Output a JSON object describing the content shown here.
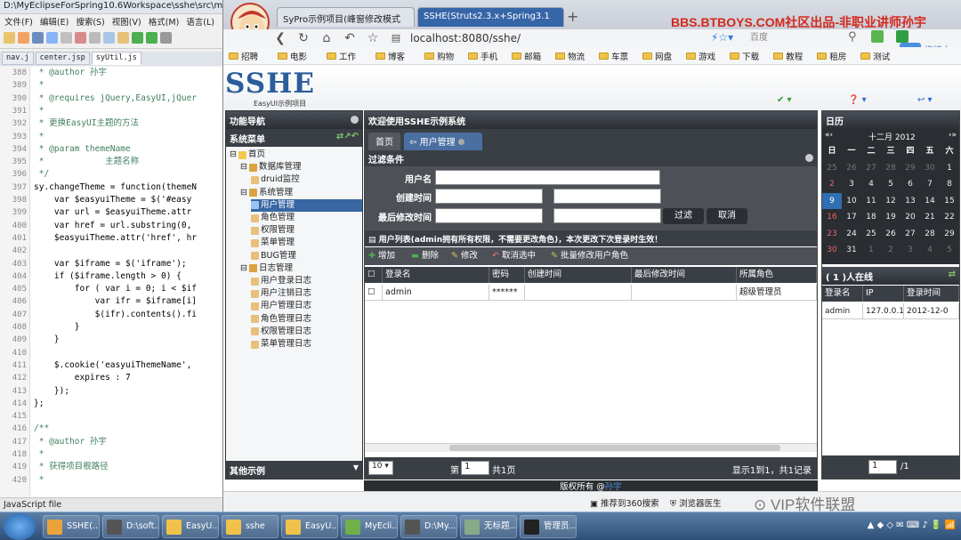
{
  "eclipse": {
    "title": "D:\\MyEclipseForSpring10.6Workspace\\sshe\\src\\m",
    "menu": [
      "文件(F)",
      "编辑(E)",
      "搜索(S)",
      "视图(V)",
      "格式(M)",
      "语言(L)"
    ],
    "tabs": [
      "nav.j",
      "center.jsp",
      "syUtil.js"
    ],
    "lines": [
      {
        "n": "388",
        "t": " * @author 孙宇"
      },
      {
        "n": "389",
        "t": " *"
      },
      {
        "n": "390",
        "t": " * @requires jQuery,EasyUI,jQuer"
      },
      {
        "n": "391",
        "t": " *"
      },
      {
        "n": "392",
        "t": " * 更换EasyUI主题的方法"
      },
      {
        "n": "393",
        "t": " *"
      },
      {
        "n": "394",
        "t": " * @param themeName"
      },
      {
        "n": "395",
        "t": " *            主题名称"
      },
      {
        "n": "396",
        "t": " */"
      },
      {
        "n": "397",
        "t": "sy.changeTheme = function(themeN"
      },
      {
        "n": "398",
        "t": "    var $easyuiTheme = $('#easy"
      },
      {
        "n": "399",
        "t": "    var url = $easyuiTheme.attr"
      },
      {
        "n": "400",
        "t": "    var href = url.substring(0,"
      },
      {
        "n": "401",
        "t": "    $easyuiTheme.attr('href', hr"
      },
      {
        "n": "402",
        "t": ""
      },
      {
        "n": "403",
        "t": "    var $iframe = $('iframe');"
      },
      {
        "n": "404",
        "t": "    if ($iframe.length > 0) {"
      },
      {
        "n": "405",
        "t": "        for ( var i = 0; i < $if"
      },
      {
        "n": "406",
        "t": "            var ifr = $iframe[i]"
      },
      {
        "n": "407",
        "t": "            $(ifr).contents().fi"
      },
      {
        "n": "408",
        "t": "        }"
      },
      {
        "n": "409",
        "t": "    }"
      },
      {
        "n": "410",
        "t": ""
      },
      {
        "n": "411",
        "t": "    $.cookie('easyuiThemeName',"
      },
      {
        "n": "412",
        "t": "        expires : 7"
      },
      {
        "n": "413",
        "t": "    });"
      },
      {
        "n": "414",
        "t": "};"
      },
      {
        "n": "415",
        "t": ""
      },
      {
        "n": "416",
        "t": "/**"
      },
      {
        "n": "417",
        "t": " * @author 孙宇"
      },
      {
        "n": "418",
        "t": " *"
      },
      {
        "n": "419",
        "t": " * 获得项目根路径"
      },
      {
        "n": "420",
        "t": " *"
      }
    ],
    "status": "JavaScript file"
  },
  "browser": {
    "tabs": [
      "SyPro示例项目(峰窗修改模式",
      "SSHE(Struts2.3.x+Spring3.1"
    ],
    "slogan": "BBS.BTBOYS.COM社区出品-非职业讲师孙宇",
    "url": "localhost:8080/sshe/",
    "search": "百度",
    "bookmarks": [
      "招聘",
      "电影",
      "工作",
      "博客",
      "购物",
      "手机",
      "邮箱",
      "物流",
      "车票",
      "网盘",
      "游戏",
      "下载",
      "教程",
      "租房",
      "测试"
    ],
    "drag_btn": "拖拽上"
  },
  "app": {
    "brand": "SSHE",
    "brand_sub": "EasyUI示例项目",
    "west": {
      "header": "功能导航",
      "sub_header": "系统菜单",
      "footer": "其他示例",
      "tree": [
        {
          "label": "首页",
          "level": 0
        },
        {
          "label": "数据库管理",
          "level": 1
        },
        {
          "label": "druid监控",
          "level": 2
        },
        {
          "label": "系统管理",
          "level": 1
        },
        {
          "label": "用户管理",
          "level": 2,
          "selected": true
        },
        {
          "label": "角色管理",
          "level": 2
        },
        {
          "label": "权限管理",
          "level": 2
        },
        {
          "label": "菜单管理",
          "level": 2
        },
        {
          "label": "BUG管理",
          "level": 2
        },
        {
          "label": "日志管理",
          "level": 1
        },
        {
          "label": "用户登录日志",
          "level": 2
        },
        {
          "label": "用户注销日志",
          "level": 2
        },
        {
          "label": "用户管理日志",
          "level": 2
        },
        {
          "label": "角色管理日志",
          "level": 2
        },
        {
          "label": "权限管理日志",
          "level": 2
        },
        {
          "label": "菜单管理日志",
          "level": 2
        }
      ]
    },
    "center": {
      "header": "欢迎使用SSHE示例系统",
      "tabs": [
        "首页",
        "用户管理"
      ],
      "filter_title": "过滤条件",
      "filter": {
        "username_label": "用户名",
        "created_label": "创建时间",
        "modified_label": "最后修改时间",
        "filter_btn": "过滤",
        "cancel_btn": "取消"
      },
      "list_title": "用户列表(admin拥有所有权限，不需要更改角色)，本次更改下次登录时生效！",
      "toolbar": [
        "增加",
        "删除",
        "修改",
        "取消选中",
        "批量修改用户角色"
      ],
      "columns": [
        "登录名",
        "密码",
        "创建时间",
        "最后修改时间",
        "所属角色"
      ],
      "rows": [
        {
          "login": "admin",
          "password": "******",
          "created": "",
          "modified": "",
          "role": "超级管理员"
        }
      ],
      "pager": {
        "size": "10",
        "page": "1",
        "pages_label": "共1页",
        "info": "显示1到1，共1记录"
      }
    },
    "east": {
      "calendar_header": "日历",
      "month": "十二月 2012",
      "weekdays": [
        "日",
        "一",
        "二",
        "三",
        "四",
        "五",
        "六"
      ],
      "days": [
        "25",
        "26",
        "27",
        "28",
        "29",
        "30",
        "1",
        "2",
        "3",
        "4",
        "5",
        "6",
        "7",
        "8",
        "9",
        "10",
        "11",
        "12",
        "13",
        "14",
        "15",
        "16",
        "17",
        "18",
        "19",
        "20",
        "21",
        "22",
        "23",
        "24",
        "25",
        "26",
        "27",
        "28",
        "29",
        "30",
        "31",
        "1",
        "2",
        "3",
        "4",
        "5"
      ],
      "online_header": "( 1 )人在线",
      "online_cols": [
        "登录名",
        "IP",
        "登录时间"
      ],
      "online_rows": [
        {
          "name": "admin",
          "ip": "127.0.0.1",
          "time": "2012-12-0"
        }
      ],
      "pager_page": "1",
      "pager_total": "/1"
    },
    "footer": "版权所有 @",
    "footer_link": "孙宇"
  },
  "status_bar": {
    "items": [
      "推荐到360搜索",
      "浏览器医生"
    ],
    "watermark": "VIP软件联盟"
  },
  "taskbar": {
    "tasks": [
      "SSHE(...",
      "D:\\soft...",
      "EasyU...",
      "sshe",
      "EasyU...",
      "MyEcli...",
      "D:\\My...",
      "无标题...",
      "管理员..."
    ]
  }
}
